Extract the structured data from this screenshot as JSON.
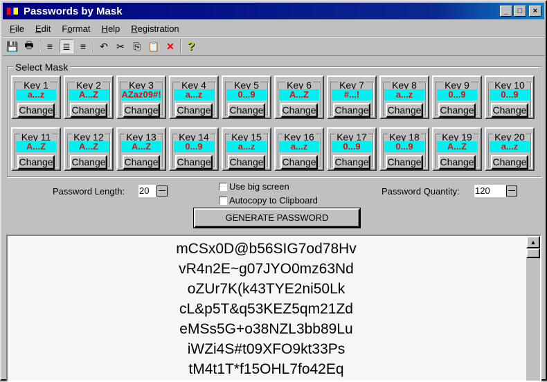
{
  "window": {
    "title": "Passwords by Mask",
    "minimize": "_",
    "maximize": "□",
    "close": "×"
  },
  "menu": [
    {
      "label": "File",
      "key": "F",
      "rest": "ile"
    },
    {
      "label": "Edit",
      "key": "E",
      "rest": "dit"
    },
    {
      "label": "Format",
      "key": "o",
      "pre": "F",
      "rest": "rmat"
    },
    {
      "label": "Help",
      "key": "H",
      "rest": "elp"
    },
    {
      "label": "Registration",
      "key": "R",
      "rest": "egistration"
    }
  ],
  "toolbar": {
    "save": "💾",
    "print": "🖶",
    "align_left": "≡",
    "align_center": "≣",
    "align_right": "≡",
    "undo": "↶",
    "cut": "✂",
    "copy": "⎘",
    "paste": "📋",
    "delete": "✕",
    "help": "?"
  },
  "mask_group": {
    "label": "Select Mask"
  },
  "keys": [
    {
      "label": "Key 1",
      "mask": "a...z"
    },
    {
      "label": "Key 2",
      "mask": "A...Z"
    },
    {
      "label": "Key 3",
      "mask": "AZaz09#!"
    },
    {
      "label": "Key 4",
      "mask": "a...z"
    },
    {
      "label": "Key 5",
      "mask": "0...9"
    },
    {
      "label": "Key 6",
      "mask": "A...Z"
    },
    {
      "label": "Key 7",
      "mask": "#...!"
    },
    {
      "label": "Key 8",
      "mask": "a...z"
    },
    {
      "label": "Key 9",
      "mask": "0...9"
    },
    {
      "label": "Key 10",
      "mask": "0...9"
    },
    {
      "label": "Key 11",
      "mask": "A...Z"
    },
    {
      "label": "Key 12",
      "mask": "A...Z"
    },
    {
      "label": "Key 13",
      "mask": "A...Z"
    },
    {
      "label": "Key 14",
      "mask": "0...9"
    },
    {
      "label": "Key 15",
      "mask": "a...z"
    },
    {
      "label": "Key 16",
      "mask": "a...z"
    },
    {
      "label": "Key 17",
      "mask": "0...9"
    },
    {
      "label": "Key 18",
      "mask": "0...9"
    },
    {
      "label": "Key 19",
      "mask": "A...Z"
    },
    {
      "label": "Key 20",
      "mask": "a...z"
    }
  ],
  "change_label": "Change",
  "options": {
    "length_label": "Password Length:",
    "length_value": "20",
    "quantity_label": "Password Quantity:",
    "quantity_value": "120",
    "big_screen": "Use big screen",
    "autocopy": "Autocopy to Clipboard",
    "generate": "GENERATE PASSWORD"
  },
  "passwords": [
    "mCSx0D@b56SIG7od78Hv",
    "vR4n2E~g07JYO0mz63Nd",
    "oZUr7K(k43TYE2ni50Lk",
    "cL&p5T&q53KEZ5qm21Zd",
    "eMSs5G+o38NZL3bb89Lu",
    "iWZi4S#t09XFO9kt33Ps",
    "tM4t1T*f15OHL7fo42Eq"
  ]
}
